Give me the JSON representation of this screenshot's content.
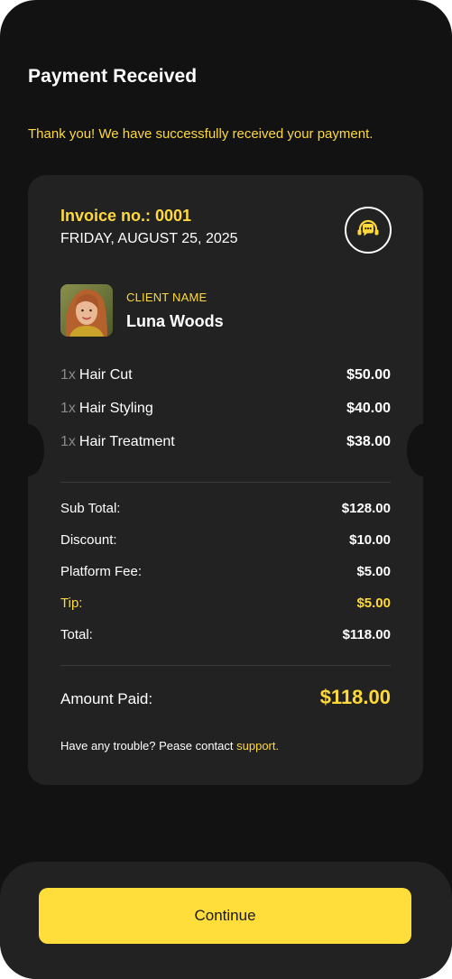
{
  "header": {
    "title": "Payment Received",
    "subtitle": "Thank you! We have successfully received your payment."
  },
  "invoice": {
    "label": "Invoice no.: 0001",
    "date": "FRIDAY, AUGUST 25, 2025",
    "support_icon": "headset-chat-icon"
  },
  "client": {
    "label": "CLIENT NAME",
    "name": "Luna Woods"
  },
  "items": [
    {
      "qty": "1x",
      "name": "Hair Cut",
      "price": "$50.00"
    },
    {
      "qty": "1x",
      "name": "Hair Styling",
      "price": "$40.00"
    },
    {
      "qty": "1x",
      "name": "Hair Treatment",
      "price": "$38.00"
    }
  ],
  "summary": {
    "subtotal_label": "Sub Total:",
    "subtotal_value": "$128.00",
    "discount_label": "Discount:",
    "discount_value": "$10.00",
    "fee_label": "Platform Fee:",
    "fee_value": "$5.00",
    "tip_label": "Tip:",
    "tip_value": "$5.00",
    "total_label": "Total:",
    "total_value": "$118.00"
  },
  "amount_paid": {
    "label": "Amount Paid:",
    "value": "$118.00"
  },
  "trouble": {
    "text": "Have any trouble? Pease contact ",
    "link": "support."
  },
  "actions": {
    "continue_label": "Continue"
  },
  "colors": {
    "background": "#121212",
    "card": "#222222",
    "accent": "#ffd93b",
    "button": "#ffdd3b"
  }
}
